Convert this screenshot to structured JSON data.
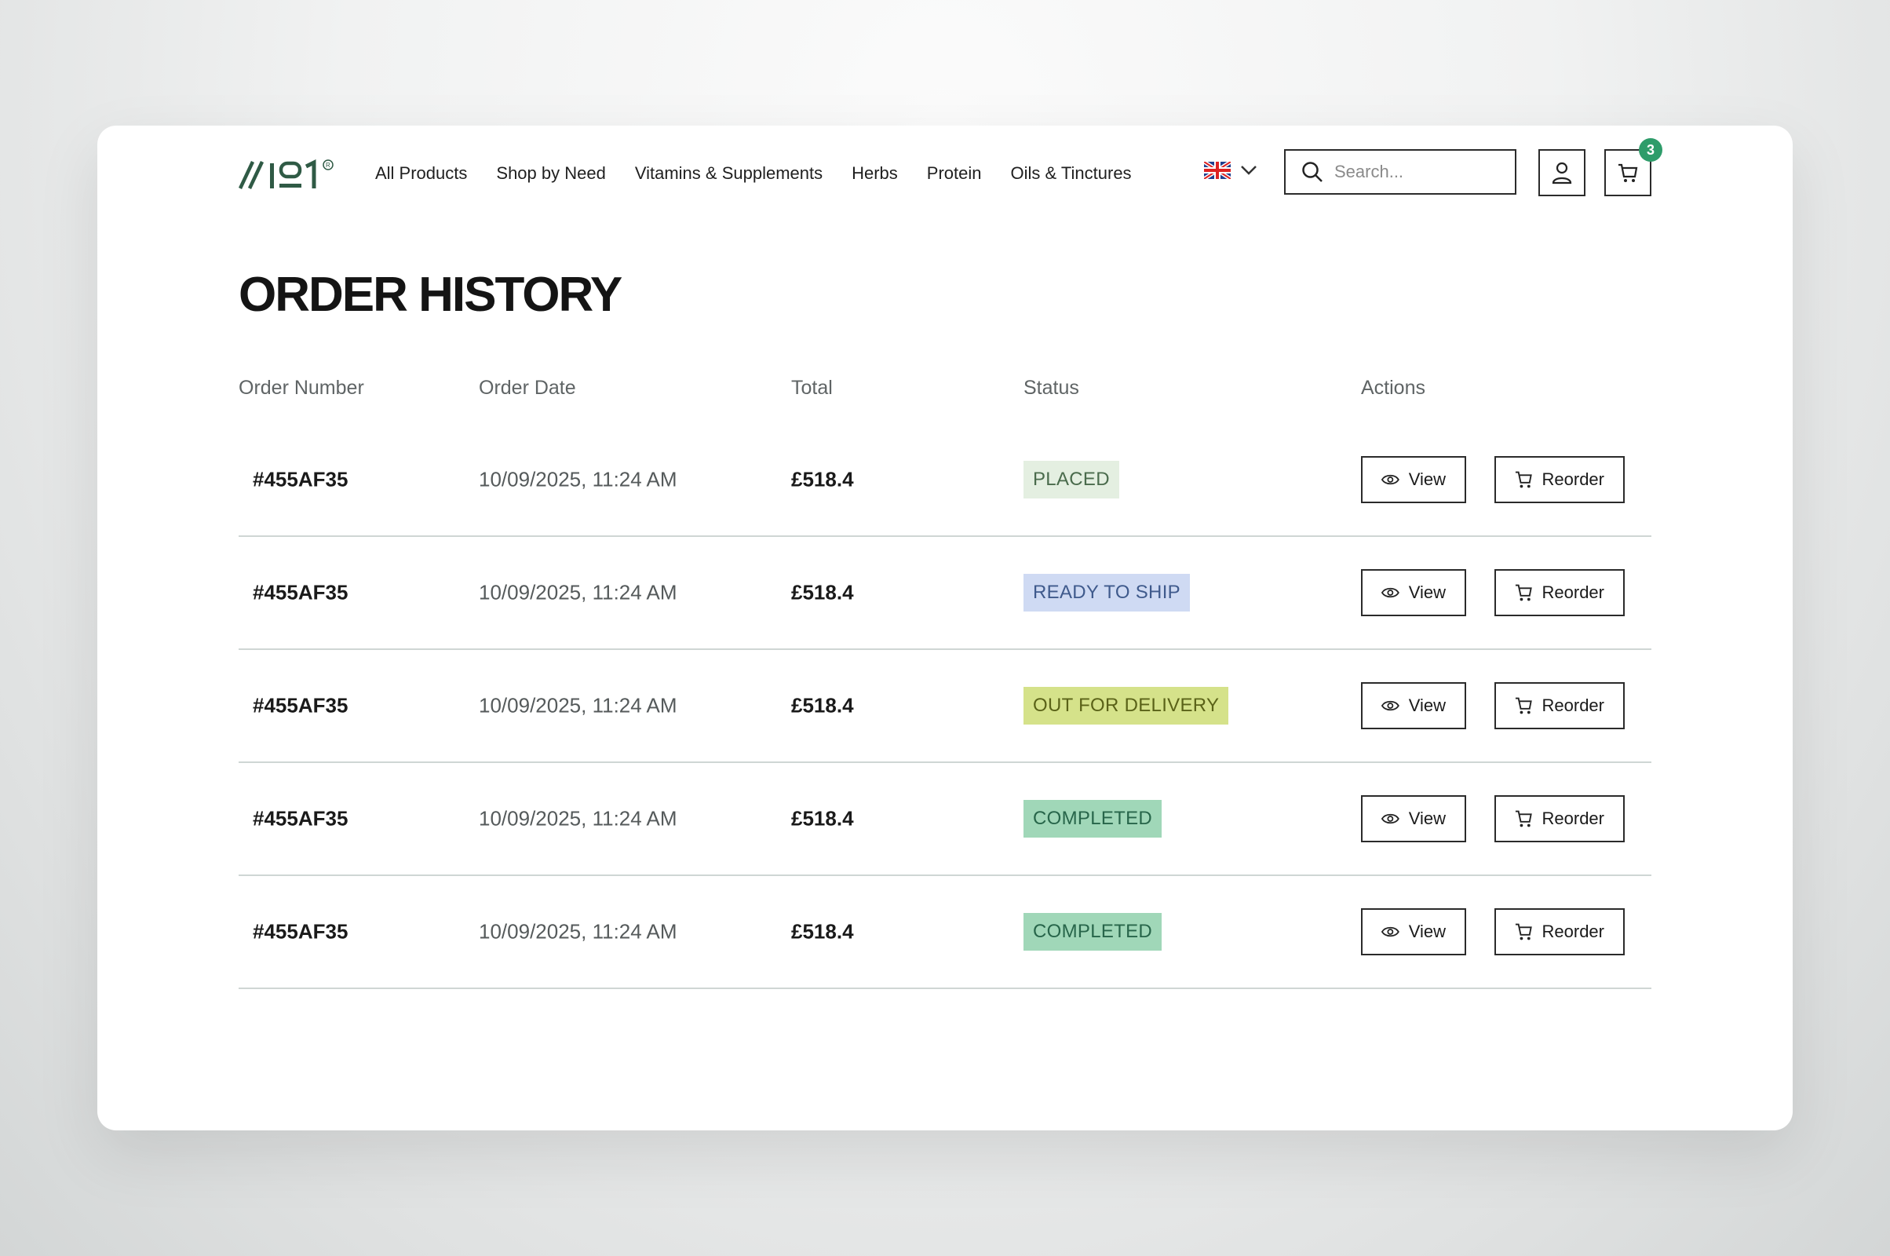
{
  "header": {
    "logo_text": "//191®",
    "nav": [
      "All Products",
      "Shop by Need",
      "Vitamins & Supplements",
      "Herbs",
      "Protein",
      "Oils & Tinctures"
    ],
    "language_icon": "uk-flag-icon",
    "search_placeholder": "Search...",
    "cart_count": "3"
  },
  "page_title": "ORDER HISTORY",
  "table": {
    "headers": [
      "Order Number",
      "Order Date",
      "Total",
      "Status",
      "Actions"
    ],
    "rows": [
      {
        "number": "#455AF35",
        "date": "10/09/2025, 11:24 AM",
        "total": "£518.4",
        "status": "PLACED",
        "view": "View",
        "reorder": "Reorder"
      },
      {
        "number": "#455AF35",
        "date": "10/09/2025, 11:24 AM",
        "total": "£518.4",
        "status": "READY TO SHIP",
        "view": "View",
        "reorder": "Reorder"
      },
      {
        "number": "#455AF35",
        "date": "10/09/2025, 11:24 AM",
        "total": "£518.4",
        "status": "OUT FOR DELIVERY",
        "view": "View",
        "reorder": "Reorder"
      },
      {
        "number": "#455AF35",
        "date": "10/09/2025, 11:24 AM",
        "total": "£518.4",
        "status": "COMPLETED",
        "view": "View",
        "reorder": "Reorder"
      },
      {
        "number": "#455AF35",
        "date": "10/09/2025, 11:24 AM",
        "total": "£518.4",
        "status": "COMPLETED",
        "view": "View",
        "reorder": "Reorder"
      }
    ]
  },
  "status_colors": {
    "PLACED": {
      "bg": "#e4efe1",
      "fg": "#4a6b4c"
    },
    "READY TO SHIP": {
      "bg": "#cfdaf3",
      "fg": "#3f5a8c"
    },
    "OUT FOR DELIVERY": {
      "bg": "#d5e28a",
      "fg": "#5a6218"
    },
    "COMPLETED": {
      "bg": "#a0d7b8",
      "fg": "#27654a"
    }
  },
  "colors": {
    "brand": "#2f5a45",
    "badge": "#2e9c6a"
  }
}
